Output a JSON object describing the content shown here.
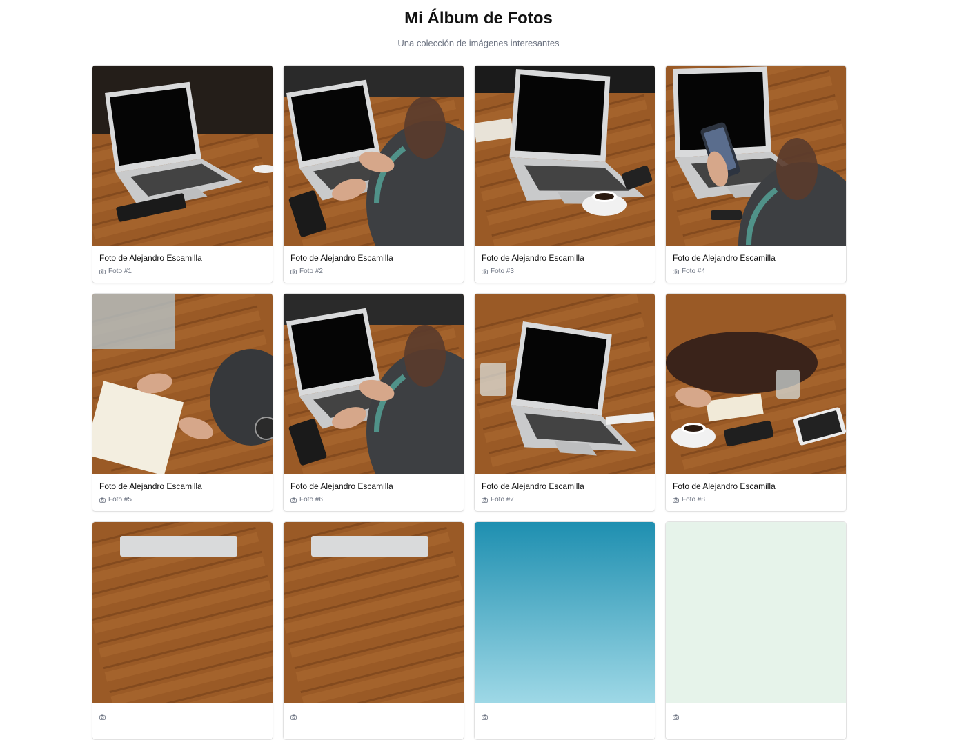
{
  "header": {
    "title": "Mi Álbum de Fotos",
    "subtitle": "Una colección de imágenes interesantes"
  },
  "photos": [
    {
      "title": "Foto de Alejandro Escamilla",
      "label": "Foto #1",
      "scene": "laptop-desk"
    },
    {
      "title": "Foto de Alejandro Escamilla",
      "label": "Foto #2",
      "scene": "person-typing"
    },
    {
      "title": "Foto de Alejandro Escamilla",
      "label": "Foto #3",
      "scene": "laptop-coffee"
    },
    {
      "title": "Foto de Alejandro Escamilla",
      "label": "Foto #4",
      "scene": "phone-in-hand"
    },
    {
      "title": "Foto de Alejandro Escamilla",
      "label": "Foto #5",
      "scene": "hand-writing"
    },
    {
      "title": "Foto de Alejandro Escamilla",
      "label": "Foto #6",
      "scene": "person-typing"
    },
    {
      "title": "Foto de Alejandro Escamilla",
      "label": "Foto #7",
      "scene": "laptop-glass"
    },
    {
      "title": "Foto de Alejandro Escamilla",
      "label": "Foto #8",
      "scene": "bag-table"
    },
    {
      "title": "",
      "label": "",
      "scene": "laptop-wood"
    },
    {
      "title": "",
      "label": "",
      "scene": "laptop-wood"
    },
    {
      "title": "",
      "label": "",
      "scene": "sky-blue"
    },
    {
      "title": "",
      "label": "",
      "scene": "sky-pale"
    }
  ],
  "icons": {
    "caption": "camera-icon"
  },
  "colors": {
    "wood": "#9a5a26",
    "wood_light": "#b8753a",
    "laptop": "#d9dadb",
    "screen": "#050505",
    "sky": "#4fb6cc",
    "pale": "#e6f3ea"
  }
}
